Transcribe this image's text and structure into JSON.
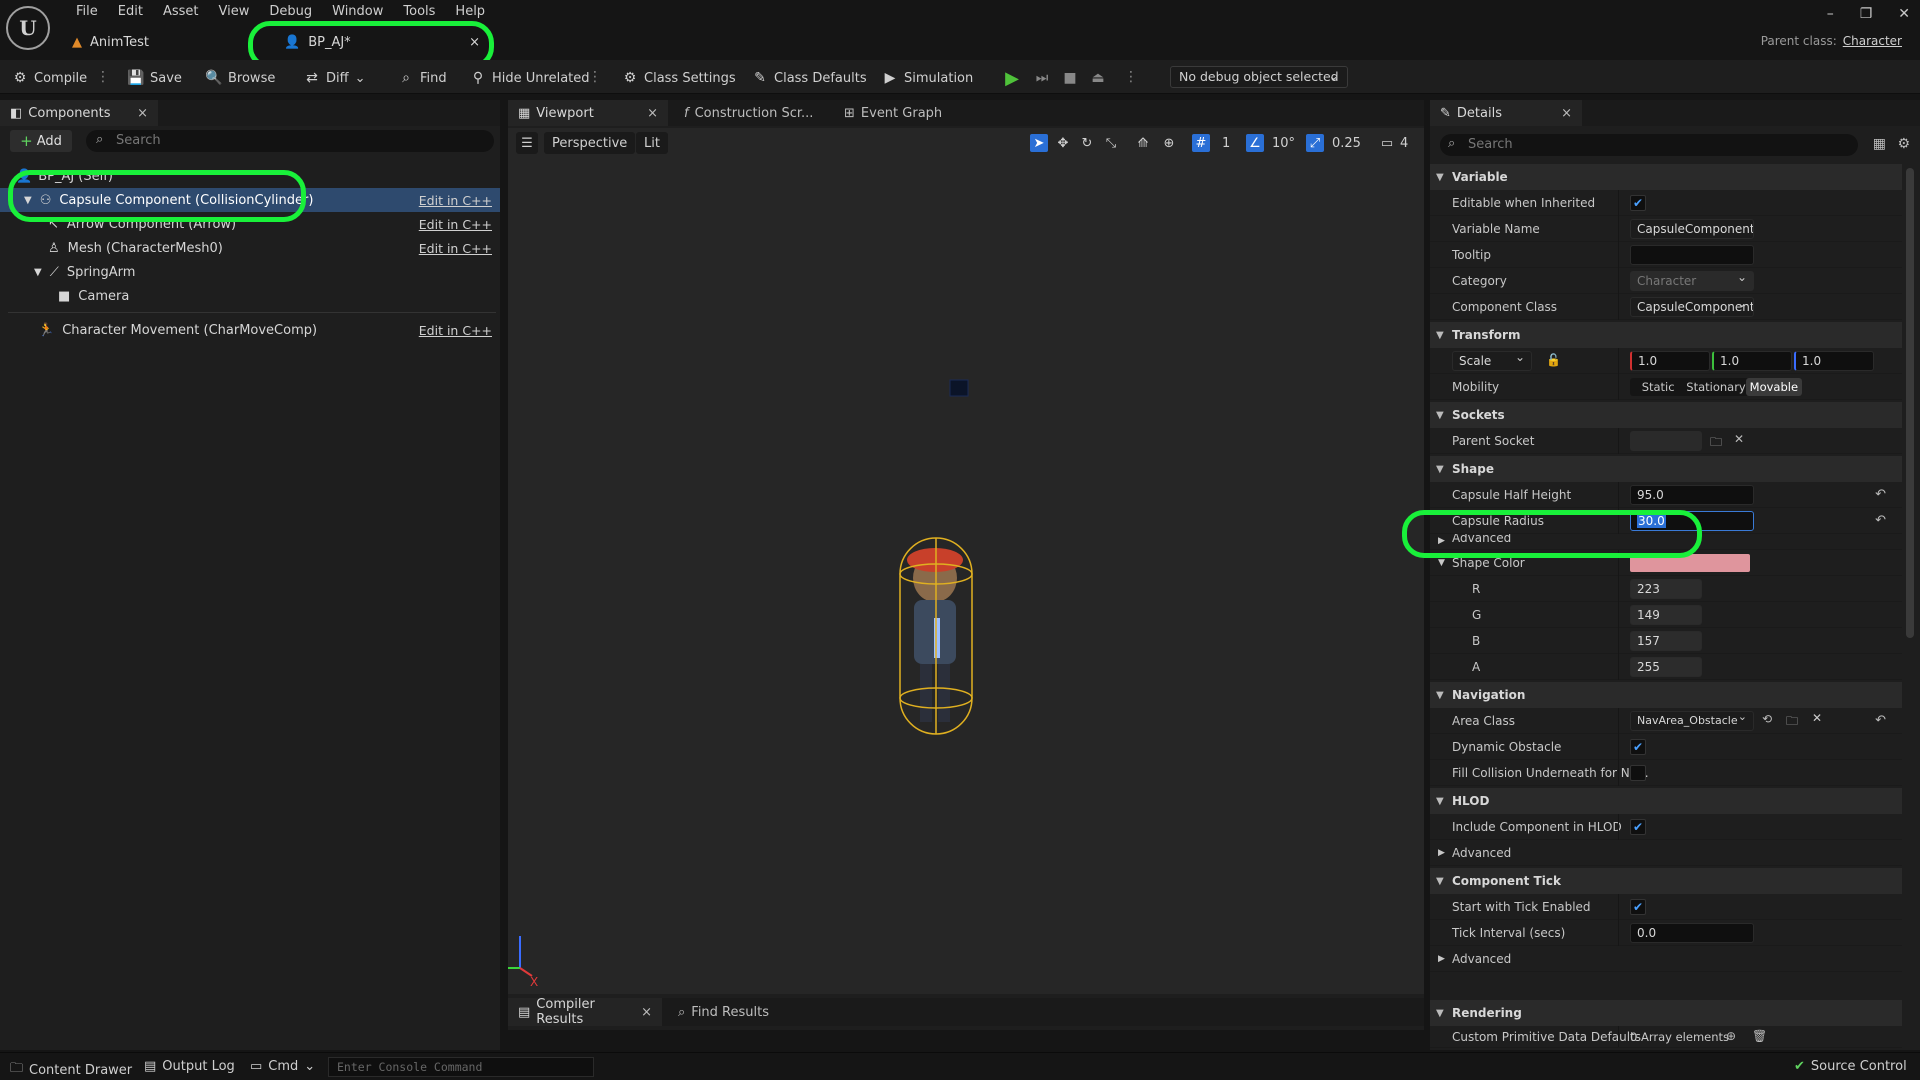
{
  "menu": [
    "File",
    "Edit",
    "Asset",
    "View",
    "Debug",
    "Window",
    "Tools",
    "Help"
  ],
  "doc_tabs": {
    "animtest": "AnimTest",
    "bp": "BP_AJ*"
  },
  "parent_class": {
    "label": "Parent class:",
    "value": "Character"
  },
  "toolbar": {
    "compile": "Compile",
    "save": "Save",
    "browse": "Browse",
    "diff": "Diff",
    "find": "Find",
    "hide_unrelated": "Hide Unrelated",
    "class_settings": "Class Settings",
    "class_defaults": "Class Defaults",
    "simulation": "Simulation",
    "debug_object": "No debug object selected"
  },
  "components": {
    "tab": "Components",
    "add": "Add",
    "search_placeholder": "Search",
    "root": "BP_AJ (Self)",
    "items": [
      {
        "label": "Capsule Component (CollisionCylinder)",
        "edit": "Edit in C++"
      },
      {
        "label": "Arrow Component (Arrow)",
        "edit": "Edit in C++"
      },
      {
        "label": "Mesh (CharacterMesh0)",
        "edit": "Edit in C++"
      },
      {
        "label": "SpringArm",
        "edit": ""
      },
      {
        "label": "Camera",
        "edit": ""
      },
      {
        "label": "Character Movement (CharMoveComp)",
        "edit": "Edit in C++"
      }
    ]
  },
  "editor_tabs": {
    "viewport": "Viewport",
    "construction": "Construction Scr...",
    "event_graph": "Event Graph"
  },
  "viewport": {
    "perspective": "Perspective",
    "lit": "Lit",
    "grid_snap": "1",
    "rot_snap": "10°",
    "scale_snap": "0.25",
    "cam_speed": "4",
    "axis_x": "X"
  },
  "bottom_tabs": {
    "compiler": "Compiler Results",
    "find": "Find Results"
  },
  "details": {
    "tab": "Details",
    "search_placeholder": "Search",
    "sections": {
      "variable": "Variable",
      "transform": "Transform",
      "sockets": "Sockets",
      "shape": "Shape",
      "navigation": "Navigation",
      "hlod": "HLOD",
      "component_tick": "Component Tick",
      "rendering": "Rendering"
    },
    "props": {
      "editable_inherited": "Editable when Inherited",
      "variable_name": "Variable Name",
      "variable_name_val": "CapsuleComponent",
      "tooltip": "Tooltip",
      "category": "Category",
      "category_val": "Character",
      "component_class": "Component Class",
      "component_class_val": "CapsuleComponent",
      "scale": "Scale",
      "scale_x": "1.0",
      "scale_y": "1.0",
      "scale_z": "1.0",
      "mobility": "Mobility",
      "static": "Static",
      "stationary": "Stationary",
      "movable": "Movable",
      "parent_socket": "Parent Socket",
      "half_height": "Capsule Half Height",
      "half_height_val": "95.0",
      "radius": "Capsule Radius",
      "radius_val": "30.0",
      "advanced": "Advanced",
      "shape_color": "Shape Color",
      "r": "R",
      "r_val": "223",
      "g": "G",
      "g_val": "149",
      "b": "B",
      "b_val": "157",
      "a": "A",
      "a_val": "255",
      "area_class": "Area Class",
      "area_class_val": "NavArea_Obstacle",
      "dynamic_obstacle": "Dynamic Obstacle",
      "fill_collision": "Fill Collision Underneath for Na...",
      "include_hlod": "Include Component in HLOD",
      "advanced2": "Advanced",
      "start_tick": "Start with Tick Enabled",
      "tick_interval": "Tick Interval (secs)",
      "tick_interval_val": "0.0",
      "advanced3": "Advanced",
      "custom_prim": "Custom Primitive Data Defaults",
      "custom_prim_val": "0 Array elements"
    }
  },
  "statusbar": {
    "content_drawer": "Content Drawer",
    "output_log": "Output Log",
    "cmd": "Cmd",
    "console_placeholder": "Enter Console Command",
    "source_control": "Source Control"
  },
  "colors": {
    "shape_color": "#df959d",
    "highlight": "#19f03a",
    "selection": "#2e4a6e"
  }
}
